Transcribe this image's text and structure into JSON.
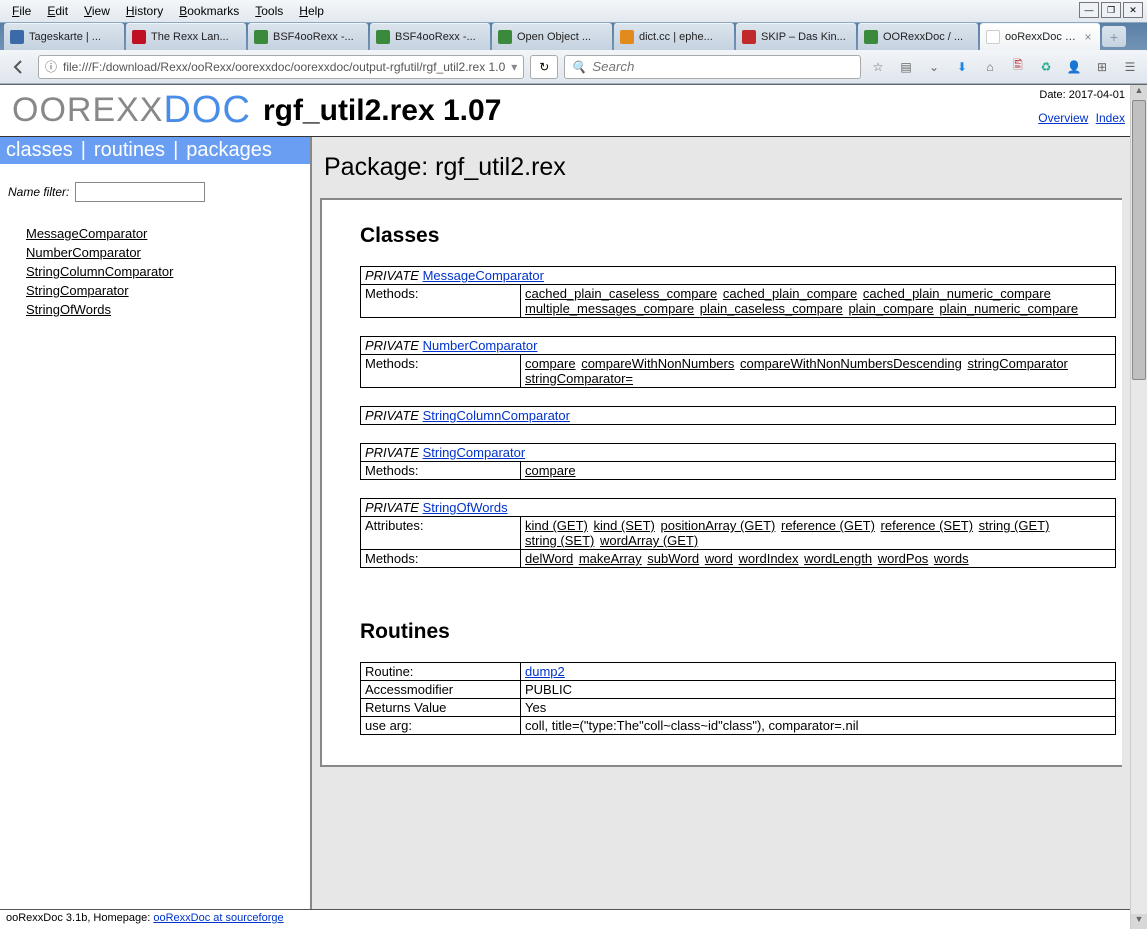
{
  "menubar": [
    "File",
    "Edit",
    "View",
    "History",
    "Bookmarks",
    "Tools",
    "Help"
  ],
  "tabs": [
    {
      "label": "Tageskarte | ...",
      "fav": "#3a6aa8"
    },
    {
      "label": "The Rexx Lan...",
      "fav": "#c01122"
    },
    {
      "label": "BSF4ooRexx -...",
      "fav": "#3b8a3b"
    },
    {
      "label": "BSF4ooRexx -...",
      "fav": "#3b8a3b"
    },
    {
      "label": "Open Object ...",
      "fav": "#3b8a3b"
    },
    {
      "label": "dict.cc | ephe...",
      "fav": "#e28a1c"
    },
    {
      "label": "SKIP – Das Kin...",
      "fav": "#c02a2a"
    },
    {
      "label": "OORexxDoc / ...",
      "fav": "#3b8a3b"
    }
  ],
  "activeTab": {
    "label": "ooRexxDoc rgf..."
  },
  "url": "file:///F:/download/Rexx/ooRexx/oorexxdoc/oorexxdoc/output-rgfutil/rgf_util2.rex 1.0",
  "searchPlaceholder": "Search",
  "date": "Date: 2017-04-01",
  "logo1": "OOREXX",
  "logo2": "DOC",
  "pageTitle": "rgf_util2.rex 1.07",
  "headerLinks": [
    "Overview",
    "Index"
  ],
  "sidebarNav": [
    "classes",
    "routines",
    "packages"
  ],
  "filterLabel": "Name filter:",
  "sidebarItems": [
    "MessageComparator",
    "NumberComparator",
    "StringColumnComparator",
    "StringComparator",
    "StringOfWords"
  ],
  "pkgTitle": "Package: rgf_util2.rex",
  "sections": {
    "classesHeading": "Classes",
    "routinesHeading": "Routines"
  },
  "classes": [
    {
      "mod": "PRIVATE",
      "name": "MessageComparator",
      "rows": [
        {
          "label": "Methods:",
          "items": [
            "cached_plain_caseless_compare",
            "cached_plain_compare",
            "cached_plain_numeric_compare",
            "multiple_messages_compare",
            "plain_caseless_compare",
            "plain_compare",
            "plain_numeric_compare"
          ]
        }
      ]
    },
    {
      "mod": "PRIVATE",
      "name": "NumberComparator",
      "rows": [
        {
          "label": "Methods:",
          "items": [
            "compare",
            "compareWithNonNumbers",
            "compareWithNonNumbersDescending",
            "stringComparator",
            "stringComparator="
          ]
        }
      ]
    },
    {
      "mod": "PRIVATE",
      "name": "StringColumnComparator",
      "rows": []
    },
    {
      "mod": "PRIVATE",
      "name": "StringComparator",
      "rows": [
        {
          "label": "Methods:",
          "items": [
            "compare"
          ]
        }
      ]
    },
    {
      "mod": "PRIVATE",
      "name": "StringOfWords",
      "rows": [
        {
          "label": "Attributes:",
          "items": [
            "kind (GET)",
            "kind (SET)",
            "positionArray (GET)",
            "reference (GET)",
            "reference (SET)",
            "string (GET)",
            "string (SET)",
            "wordArray (GET)"
          ]
        },
        {
          "label": "Methods:",
          "items": [
            "delWord",
            "makeArray",
            "subWord",
            "word",
            "wordIndex",
            "wordLength",
            "wordPos",
            "words"
          ]
        }
      ]
    }
  ],
  "routine": {
    "rows": [
      {
        "label": "Routine:",
        "value": "dump2",
        "link": true
      },
      {
        "label": "Accessmodifier",
        "value": "PUBLIC"
      },
      {
        "label": "Returns Value",
        "value": "Yes"
      },
      {
        "label": "use arg:",
        "value": "coll, title=(\"type:The\"coll~class~id\"class\"), comparator=.nil"
      }
    ]
  },
  "footer": {
    "text": "ooRexxDoc 3.1b, Homepage: ",
    "link": "ooRexxDoc at sourceforge"
  }
}
